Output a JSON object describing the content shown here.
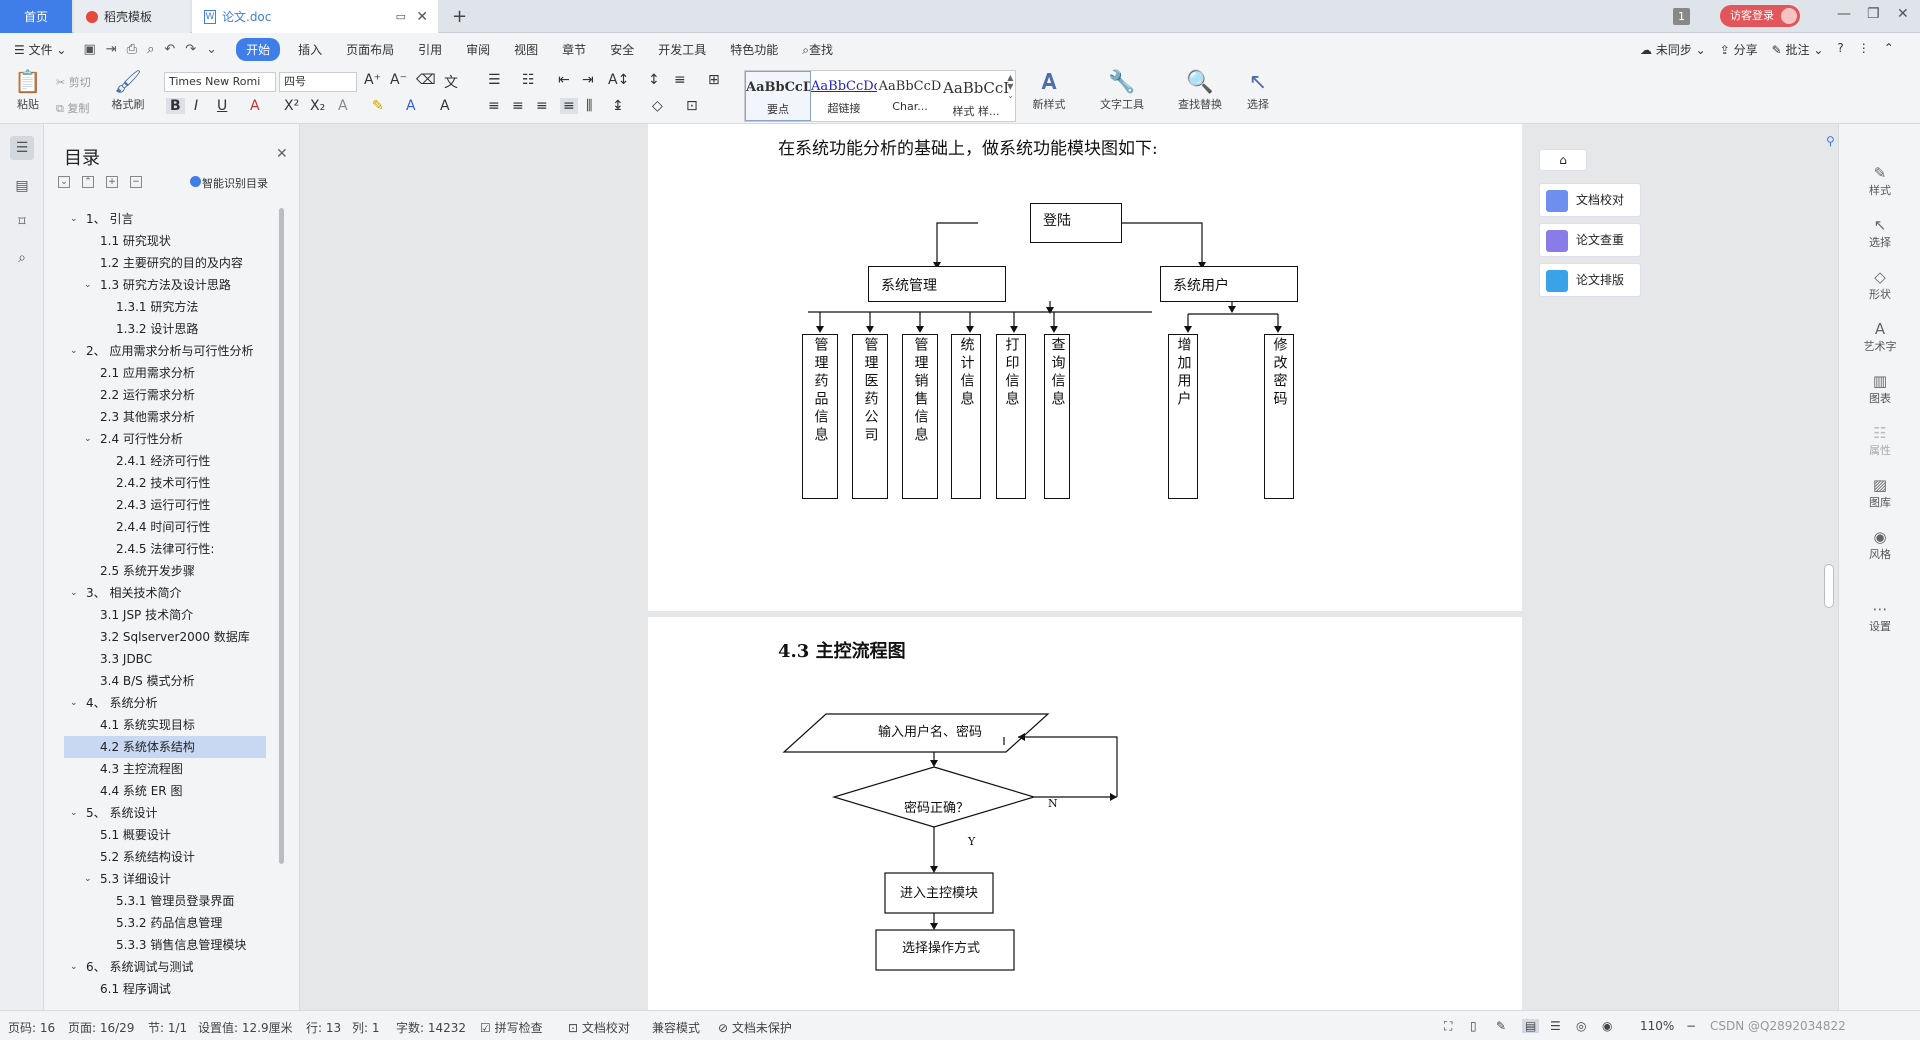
{
  "tabs": {
    "home": "首页",
    "template": "稻壳模板",
    "doc": "论文.doc"
  },
  "titlebar": {
    "badge": "1",
    "login": "访客登录"
  },
  "menu": {
    "file": "文件",
    "items": [
      "开始",
      "插入",
      "页面布局",
      "引用",
      "审阅",
      "视图",
      "章节",
      "安全",
      "开发工具",
      "特色功能"
    ],
    "search": "查找",
    "right": [
      "未同步",
      "分享",
      "批注"
    ]
  },
  "ribbon": {
    "paste": "粘贴",
    "cut": "剪切",
    "copy": "复制",
    "format_painter": "格式刷",
    "font": "Times New Romi",
    "size": "四号",
    "styles": [
      {
        "sample": "AaBbCcDd",
        "name": "要点"
      },
      {
        "sample": "AaBbCcDd",
        "name": "超链接"
      },
      {
        "sample": "AaBbCcD",
        "name": "Char..."
      },
      {
        "sample": "AaBbCcI",
        "name": "样式 样..."
      }
    ],
    "new_style": "新样式",
    "text_tool": "文字工具",
    "find_replace": "查找替换",
    "select": "选择"
  },
  "toc": {
    "title": "目录",
    "smart": "智能识别目录",
    "items": [
      {
        "text": "1、 引言",
        "level": 0,
        "expand": true
      },
      {
        "text": "1.1 研究现状",
        "level": 1
      },
      {
        "text": "1.2 主要研究的目的及内容",
        "level": 1
      },
      {
        "text": "1.3 研究方法及设计思路",
        "level": 1,
        "expand": true
      },
      {
        "text": "1.3.1 研究方法",
        "level": 2
      },
      {
        "text": "1.3.2 设计思路",
        "level": 2
      },
      {
        "text": "2、 应用需求分析与可行性分析",
        "level": 0,
        "expand": true
      },
      {
        "text": "2.1 应用需求分析",
        "level": 1
      },
      {
        "text": "2.2 运行需求分析",
        "level": 1
      },
      {
        "text": "2.3 其他需求分析",
        "level": 1
      },
      {
        "text": "2.4 可行性分析",
        "level": 1,
        "expand": true
      },
      {
        "text": "2.4.1 经济可行性",
        "level": 2
      },
      {
        "text": "2.4.2 技术可行性",
        "level": 2
      },
      {
        "text": "2.4.3 运行可行性",
        "level": 2
      },
      {
        "text": "2.4.4 时间可行性",
        "level": 2
      },
      {
        "text": "2.4.5 法律可行性:",
        "level": 2
      },
      {
        "text": "2.5 系统开发步骤",
        "level": 1
      },
      {
        "text": "3、 相关技术简介",
        "level": 0,
        "expand": true
      },
      {
        "text": "3.1 JSP 技术简介",
        "level": 1
      },
      {
        "text": "3.2 Sqlserver2000 数据库",
        "level": 1
      },
      {
        "text": "3.3 JDBC",
        "level": 1
      },
      {
        "text": "3.4 B/S 模式分析",
        "level": 1
      },
      {
        "text": "4、 系统分析",
        "level": 0,
        "expand": true
      },
      {
        "text": "4.1 系统实现目标",
        "level": 1
      },
      {
        "text": "4.2 系统体系结构",
        "level": 1,
        "selected": true
      },
      {
        "text": "4.3 主控流程图",
        "level": 1
      },
      {
        "text": "4.4 系统 ER 图",
        "level": 1
      },
      {
        "text": "5、 系统设计",
        "level": 0,
        "expand": true
      },
      {
        "text": "5.1 概要设计",
        "level": 1
      },
      {
        "text": "5.2 系统结构设计",
        "level": 1
      },
      {
        "text": "5.3 详细设计",
        "level": 1,
        "expand": true
      },
      {
        "text": "5.3.1 管理员登录界面",
        "level": 2
      },
      {
        "text": "5.3.2 药品信息管理",
        "level": 2
      },
      {
        "text": "5.3.3 销售信息管理模块",
        "level": 2
      },
      {
        "text": "6、 系统调试与测试",
        "level": 0,
        "expand": true
      },
      {
        "text": "6.1 程序调试",
        "level": 1
      }
    ]
  },
  "doc": {
    "intro": "在系统功能分析的基础上，做系统功能模块图如下:",
    "login": "登陆",
    "sys_mgmt": "系统管理",
    "sys_user": "系统用户",
    "modules": [
      "管理药品信息",
      "管理医药公司",
      "管理销售信息",
      "统计信息",
      "打印信息",
      "查询信息"
    ],
    "user_modules": [
      "增加用户",
      "修改密码"
    ],
    "heading_num": "4.3",
    "heading": "主控流程图",
    "flow_input": "输入用户名、密码",
    "flow_check": "密码正确？",
    "flow_no": "N",
    "flow_yes": "Y",
    "flow_main": "进入主控模块",
    "flow_select": "选择操作方式"
  },
  "right_float": [
    "文档校对",
    "论文查重",
    "论文排版"
  ],
  "right_panel": [
    "样式",
    "选择",
    "形状",
    "艺术字",
    "图表",
    "属性",
    "图库",
    "风格",
    "设置"
  ],
  "status": {
    "page": "页码: 16",
    "pages": "页面: 16/29",
    "section": "节: 1/1",
    "setting": "设置值: 12.9厘米",
    "row": "行: 13",
    "col": "列: 1",
    "words": "字数: 14232",
    "spell": "拼写检查",
    "proof": "文档校对",
    "compat": "兼容模式",
    "protect": "文档未保护",
    "zoom": "110%",
    "watermark": "CSDN @Q2892034822"
  }
}
